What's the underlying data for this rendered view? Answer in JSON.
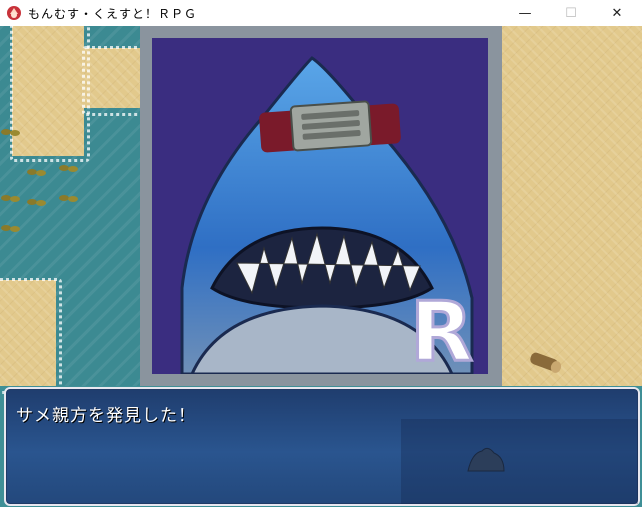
{
  "window": {
    "title": "もんむす・くえすと！ＲＰＧ",
    "controls": {
      "minimize": "—",
      "maximize": "☐",
      "close": "✕"
    }
  },
  "message": {
    "text": "サメ親方を発見した！"
  },
  "portrait": {
    "watermark": "R"
  },
  "colors": {
    "sand": "#e2c98c",
    "water": "#3c8a92",
    "portrait_bg": "#3a2d80",
    "message_bg": "#2a558f"
  }
}
